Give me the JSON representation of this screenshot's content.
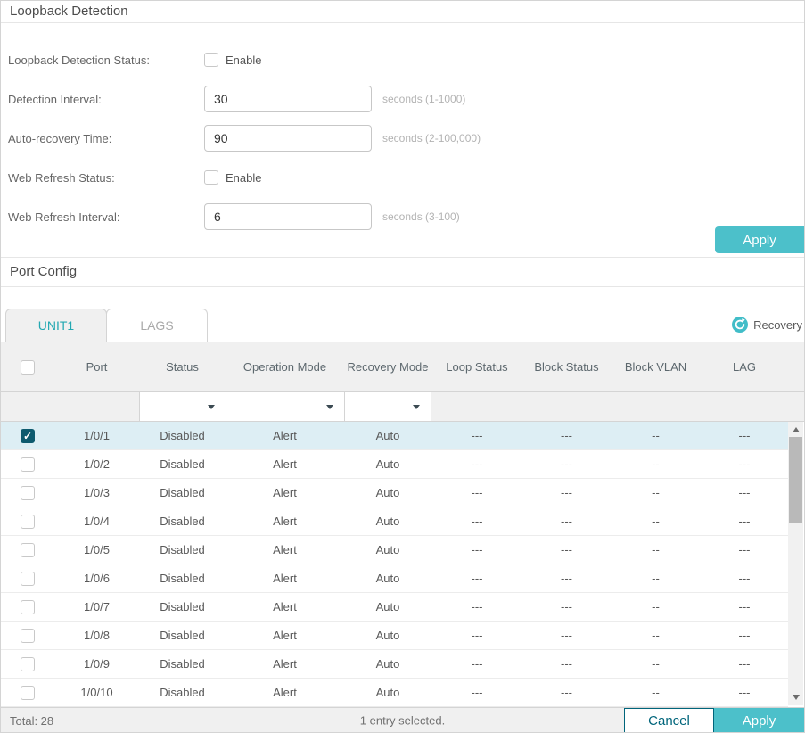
{
  "colors": {
    "accent_teal": "#4cc0ca",
    "checkbox_checked_teal": "#0d5a6e",
    "cancel_border_teal": "#00657b",
    "selected_row_bg": "#ddeef4",
    "active_tab_text": "#23a8b2"
  },
  "loopback": {
    "title": "Loopback Detection",
    "status_label": "Loopback Detection Status:",
    "status_checkbox_label": "Enable",
    "status_checked": false,
    "detection_interval_label": "Detection Interval:",
    "detection_interval_value": "30",
    "detection_interval_hint": "seconds (1-1000)",
    "auto_recovery_label": "Auto-recovery Time:",
    "auto_recovery_value": "90",
    "auto_recovery_hint": "seconds (2-100,000)",
    "web_refresh_status_label": "Web Refresh Status:",
    "web_refresh_checkbox_label": "Enable",
    "web_refresh_checked": false,
    "web_refresh_interval_label": "Web Refresh Interval:",
    "web_refresh_interval_value": "6",
    "web_refresh_interval_hint": "seconds (3-100)",
    "apply_label": "Apply"
  },
  "port_config": {
    "title": "Port Config",
    "tabs": [
      {
        "label": "UNIT1",
        "active": true
      },
      {
        "label": "LAGS",
        "active": false
      }
    ],
    "recovery_legend": "Recovery",
    "table": {
      "columns": [
        "Port",
        "Status",
        "Operation Mode",
        "Recovery Mode",
        "Loop Status",
        "Block Status",
        "Block VLAN",
        "LAG"
      ],
      "filter_dropdown_columns": [
        "Status",
        "Operation Mode",
        "Recovery Mode"
      ],
      "rows": [
        {
          "selected": true,
          "port": "1/0/1",
          "status": "Disabled",
          "operation_mode": "Alert",
          "recovery_mode": "Auto",
          "loop_status": "---",
          "block_status": "---",
          "block_vlan": "--",
          "lag": "---"
        },
        {
          "selected": false,
          "port": "1/0/2",
          "status": "Disabled",
          "operation_mode": "Alert",
          "recovery_mode": "Auto",
          "loop_status": "---",
          "block_status": "---",
          "block_vlan": "--",
          "lag": "---"
        },
        {
          "selected": false,
          "port": "1/0/3",
          "status": "Disabled",
          "operation_mode": "Alert",
          "recovery_mode": "Auto",
          "loop_status": "---",
          "block_status": "---",
          "block_vlan": "--",
          "lag": "---"
        },
        {
          "selected": false,
          "port": "1/0/4",
          "status": "Disabled",
          "operation_mode": "Alert",
          "recovery_mode": "Auto",
          "loop_status": "---",
          "block_status": "---",
          "block_vlan": "--",
          "lag": "---"
        },
        {
          "selected": false,
          "port": "1/0/5",
          "status": "Disabled",
          "operation_mode": "Alert",
          "recovery_mode": "Auto",
          "loop_status": "---",
          "block_status": "---",
          "block_vlan": "--",
          "lag": "---"
        },
        {
          "selected": false,
          "port": "1/0/6",
          "status": "Disabled",
          "operation_mode": "Alert",
          "recovery_mode": "Auto",
          "loop_status": "---",
          "block_status": "---",
          "block_vlan": "--",
          "lag": "---"
        },
        {
          "selected": false,
          "port": "1/0/7",
          "status": "Disabled",
          "operation_mode": "Alert",
          "recovery_mode": "Auto",
          "loop_status": "---",
          "block_status": "---",
          "block_vlan": "--",
          "lag": "---"
        },
        {
          "selected": false,
          "port": "1/0/8",
          "status": "Disabled",
          "operation_mode": "Alert",
          "recovery_mode": "Auto",
          "loop_status": "---",
          "block_status": "---",
          "block_vlan": "--",
          "lag": "---"
        },
        {
          "selected": false,
          "port": "1/0/9",
          "status": "Disabled",
          "operation_mode": "Alert",
          "recovery_mode": "Auto",
          "loop_status": "---",
          "block_status": "---",
          "block_vlan": "--",
          "lag": "---"
        },
        {
          "selected": false,
          "port": "1/0/10",
          "status": "Disabled",
          "operation_mode": "Alert",
          "recovery_mode": "Auto",
          "loop_status": "---",
          "block_status": "---",
          "block_vlan": "--",
          "lag": "---"
        }
      ]
    },
    "footer": {
      "total": "Total: 28",
      "selection_status": "1 entry selected.",
      "cancel_label": "Cancel",
      "apply_label": "Apply"
    }
  }
}
